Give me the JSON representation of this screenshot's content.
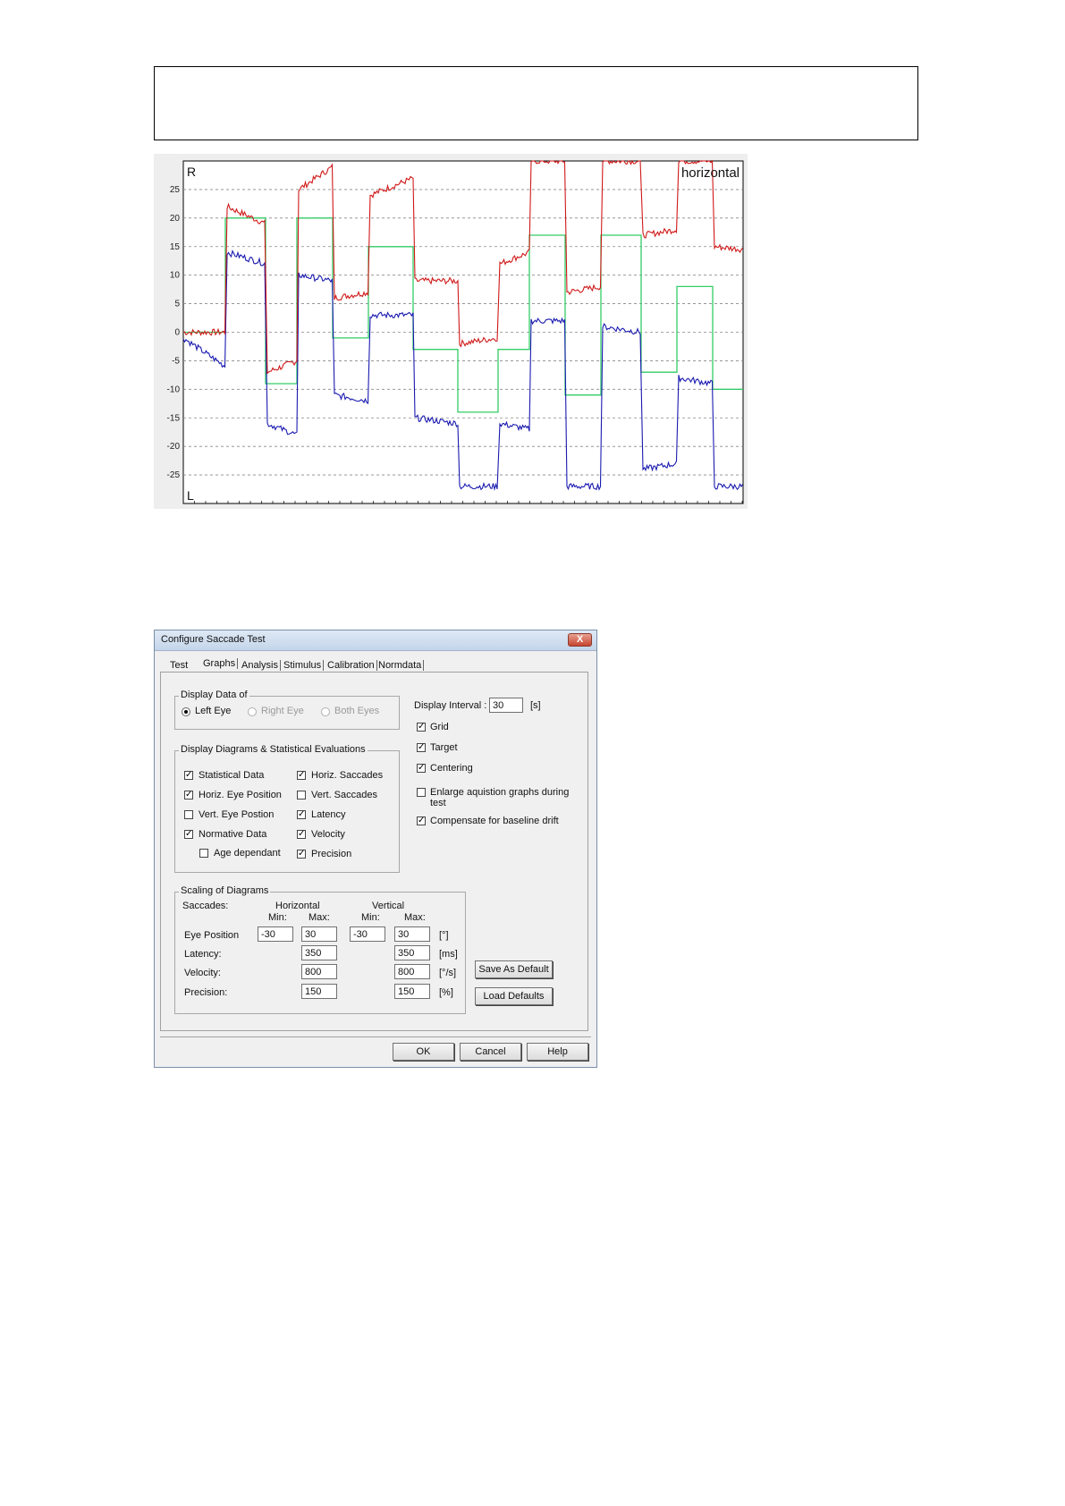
{
  "chart_data": {
    "type": "line",
    "title": "horizontal",
    "corner_top": "R",
    "corner_bottom": "L",
    "ylim": [
      -30,
      30
    ],
    "yticks": [
      25,
      20,
      15,
      10,
      5,
      0,
      -5,
      -10,
      -15,
      -20,
      -25
    ],
    "grid": true,
    "colors": {
      "red": "#d01818",
      "blue": "#1a1ab0",
      "green": "#33cc66"
    }
  },
  "dialog": {
    "title": "Configure Saccade Test",
    "close_glyph": "X",
    "tabs": [
      "Test",
      "Graphs",
      "Analysis",
      "Stimulus",
      "Calibration",
      "Normdata"
    ],
    "display_data": {
      "title": "Display Data of",
      "options": [
        {
          "label": "Left Eye",
          "selected": true
        },
        {
          "label": "Right Eye",
          "selected": false
        },
        {
          "label": "Both Eyes",
          "selected": false
        }
      ]
    },
    "display_interval": {
      "label": "Display Interval :",
      "value": "30",
      "unit": "[s]"
    },
    "right_checks": [
      {
        "label": "Grid",
        "checked": true
      },
      {
        "label": "Target",
        "checked": true
      },
      {
        "label": "Centering",
        "checked": true
      },
      {
        "label": "Enlarge aquistion graphs during",
        "label2": "test",
        "checked": false
      },
      {
        "label": "Compensate for baseline drift",
        "checked": true
      }
    ],
    "diagrams": {
      "title": "Display Diagrams & Statistical Evaluations",
      "left": [
        {
          "label": "Statistical Data",
          "checked": true
        },
        {
          "label": "Horiz. Eye Position",
          "checked": true
        },
        {
          "label": "Vert. Eye Postion",
          "checked": false
        },
        {
          "label": "Normative Data",
          "checked": true
        },
        {
          "label": "Age dependant",
          "checked": false
        }
      ],
      "right": [
        {
          "label": "Horiz. Saccades",
          "checked": true
        },
        {
          "label": "Vert. Saccades",
          "checked": false
        },
        {
          "label": "Latency",
          "checked": true
        },
        {
          "label": "Velocity",
          "checked": true
        },
        {
          "label": "Precision",
          "checked": true
        }
      ]
    },
    "scaling": {
      "title": "Scaling of Diagrams",
      "saccades_label": "Saccades:",
      "horizontal_label": "Horizontal",
      "vertical_label": "Vertical",
      "min_label": "Min:",
      "max_label": "Max:",
      "rows": [
        {
          "label": "Eye Position",
          "h_min": "-30",
          "h_max": "30",
          "v_min": "-30",
          "v_max": "30",
          "unit": "[°]"
        },
        {
          "label": "Latency:",
          "h_max": "350",
          "v_max": "350",
          "unit": "[ms]"
        },
        {
          "label": "Velocity:",
          "h_max": "800",
          "v_max": "800",
          "unit": "[°/s]"
        },
        {
          "label": "Precision:",
          "h_max": "150",
          "v_max": "150",
          "unit": "[%]"
        }
      ]
    },
    "buttons": {
      "save_default": "Save As Default",
      "load_defaults": "Load Defaults",
      "ok": "OK",
      "cancel": "Cancel",
      "help": "Help"
    }
  }
}
